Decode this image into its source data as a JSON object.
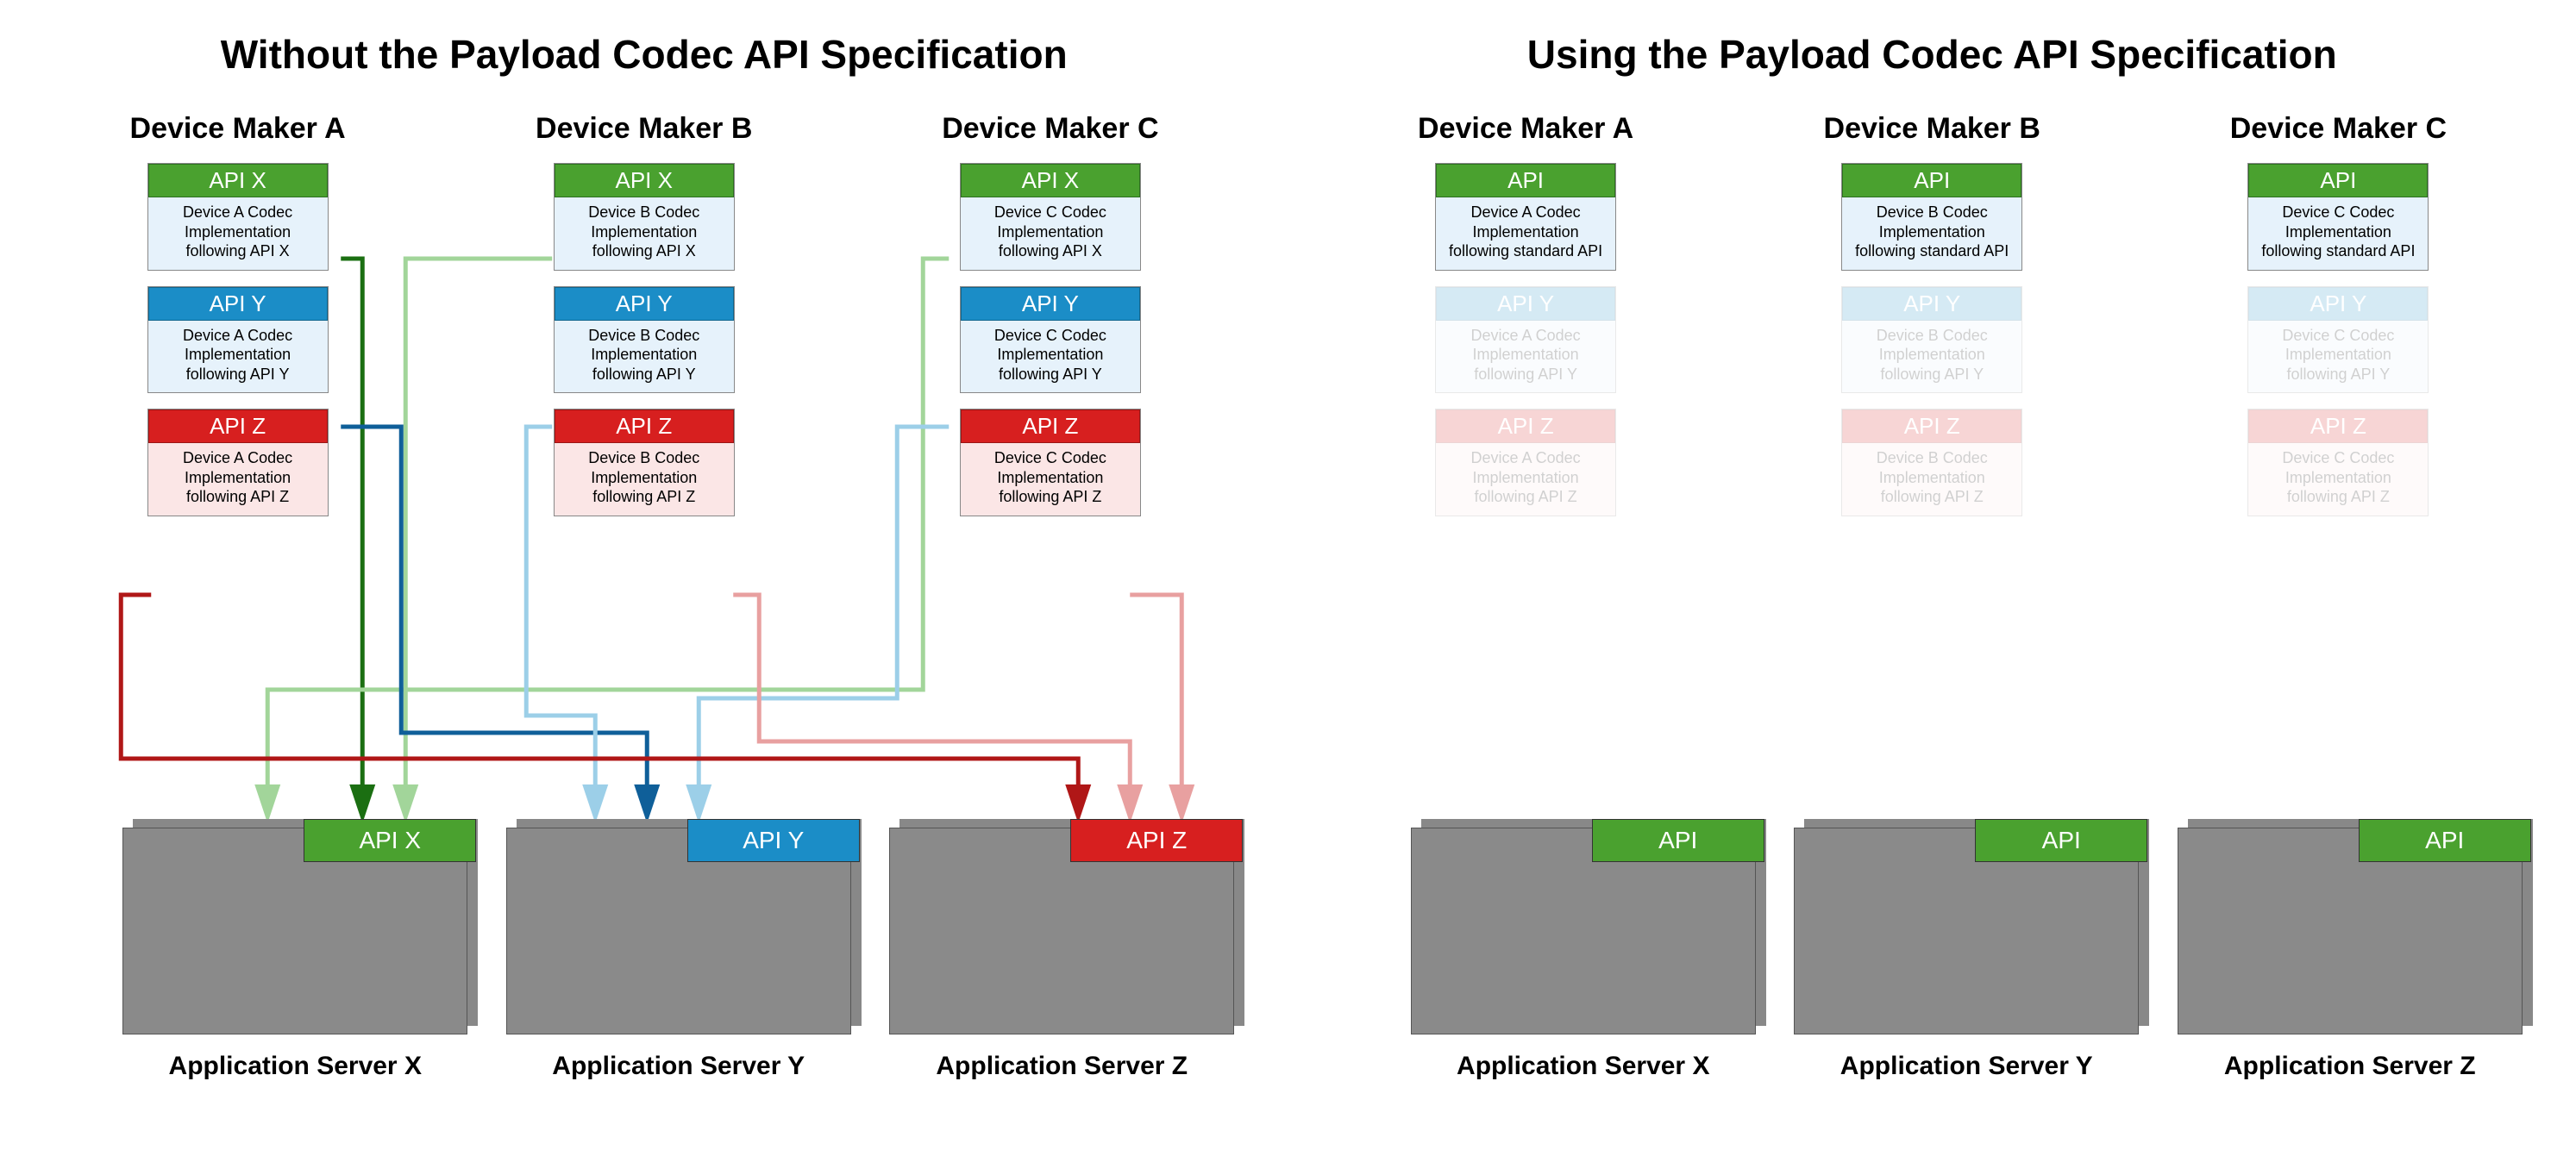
{
  "left": {
    "title": "Without the Payload Codec API Specification",
    "devices": [
      {
        "label": "Device Maker A",
        "blocks": [
          {
            "api": "API X",
            "color": "green",
            "body": "Device A Codec Implementation following API X",
            "faded": false
          },
          {
            "api": "API Y",
            "color": "blue",
            "body": "Device A Codec Implementation following API Y",
            "faded": false
          },
          {
            "api": "API Z",
            "color": "red",
            "body": "Device A Codec Implementation following API Z",
            "faded": false
          }
        ]
      },
      {
        "label": "Device Maker B",
        "blocks": [
          {
            "api": "API X",
            "color": "green",
            "body": "Device B Codec Implementation following API X",
            "faded": false
          },
          {
            "api": "API Y",
            "color": "blue",
            "body": "Device B Codec Implementation following API Y",
            "faded": false
          },
          {
            "api": "API Z",
            "color": "red",
            "body": "Device B Codec Implementation following API Z",
            "faded": false
          }
        ]
      },
      {
        "label": "Device Maker C",
        "blocks": [
          {
            "api": "API X",
            "color": "green",
            "body": "Device C Codec Implementation following API X",
            "faded": false
          },
          {
            "api": "API Y",
            "color": "blue",
            "body": "Device C Codec Implementation following API Y",
            "faded": false
          },
          {
            "api": "API Z",
            "color": "red",
            "body": "Device C Codec Implementation following API Z",
            "faded": false
          }
        ]
      }
    ],
    "servers": [
      {
        "label": "Application Server X",
        "api": "API X",
        "color": "green"
      },
      {
        "label": "Application Server Y",
        "api": "API Y",
        "color": "blue"
      },
      {
        "label": "Application Server Z",
        "api": "API Z",
        "color": "red"
      }
    ]
  },
  "right": {
    "title": "Using the Payload Codec API Specification",
    "devices": [
      {
        "label": "Device Maker A",
        "blocks": [
          {
            "api": "API",
            "color": "green",
            "body": "Device A Codec Implementation following standard API",
            "faded": false
          },
          {
            "api": "API Y",
            "color": "blue",
            "body": "Device A Codec Implementation following API Y",
            "faded": true
          },
          {
            "api": "API Z",
            "color": "red",
            "body": "Device A Codec Implementation following API Z",
            "faded": true
          }
        ]
      },
      {
        "label": "Device Maker B",
        "blocks": [
          {
            "api": "API",
            "color": "green",
            "body": "Device B Codec Implementation following standard API",
            "faded": false
          },
          {
            "api": "API Y",
            "color": "blue",
            "body": "Device B Codec Implementation following API Y",
            "faded": true
          },
          {
            "api": "API Z",
            "color": "red",
            "body": "Device B Codec Implementation following API Z",
            "faded": true
          }
        ]
      },
      {
        "label": "Device Maker C",
        "blocks": [
          {
            "api": "API",
            "color": "green",
            "body": "Device C Codec Implementation following standard API",
            "faded": false
          },
          {
            "api": "API Y",
            "color": "blue",
            "body": "Device C Codec Implementation following API Y",
            "faded": true
          },
          {
            "api": "API Z",
            "color": "red",
            "body": "Device C Codec Implementation following API Z",
            "faded": true
          }
        ]
      }
    ],
    "servers": [
      {
        "label": "Application Server X",
        "api": "API",
        "color": "green"
      },
      {
        "label": "Application Server Y",
        "api": "API",
        "color": "green"
      },
      {
        "label": "Application Server Z",
        "api": "API",
        "color": "green"
      }
    ]
  },
  "arrow_colors": {
    "green_dark": "#1b6f12",
    "green_light": "#a2d59a",
    "blue_dark": "#0f5f99",
    "blue_light": "#9ccfe8",
    "red_dark": "#b01717",
    "red_light": "#e8a0a0"
  }
}
